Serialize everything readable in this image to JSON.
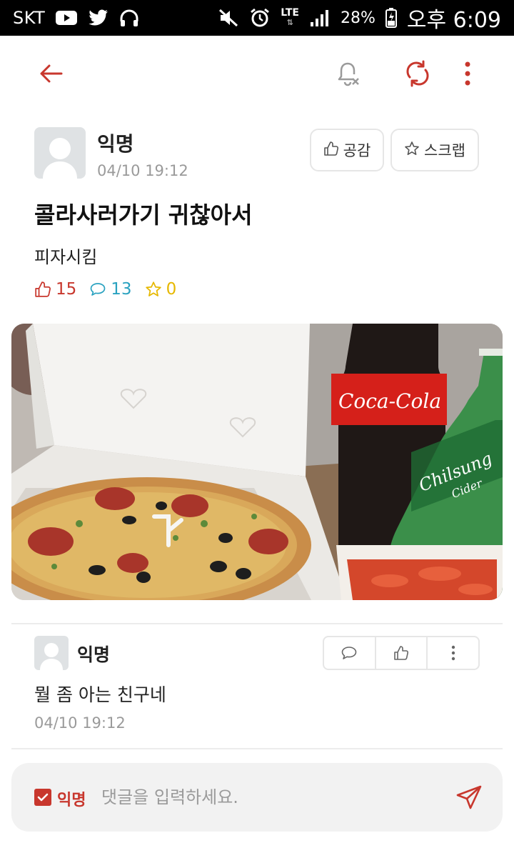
{
  "status_bar": {
    "carrier": "SKT",
    "network_top": "LTE",
    "network_bottom": "⇅",
    "battery": "28%",
    "time": "오후 6:09"
  },
  "colors": {
    "accent": "#c8372d",
    "like": "#c8372d",
    "comment": "#2aa2c0",
    "scrap": "#e6b800"
  },
  "post": {
    "author": "익명",
    "time": "04/10 19:12",
    "like_button_label": "공감",
    "scrap_button_label": "스크랩",
    "title": "콜라사러가기 귀찮아서",
    "body": "피자시킴",
    "likes": "15",
    "comments": "13",
    "scraps": "0",
    "photo": {
      "cola_label": "Coca-Cola",
      "cider_label": "Chilsung",
      "cider_sub": "Cider"
    }
  },
  "comment": {
    "author": "익명",
    "text": "뭘 좀 아는 친구네",
    "time": "04/10 19:12"
  },
  "comment_input": {
    "anonymous_label": "익명",
    "placeholder": "댓글을 입력하세요."
  }
}
